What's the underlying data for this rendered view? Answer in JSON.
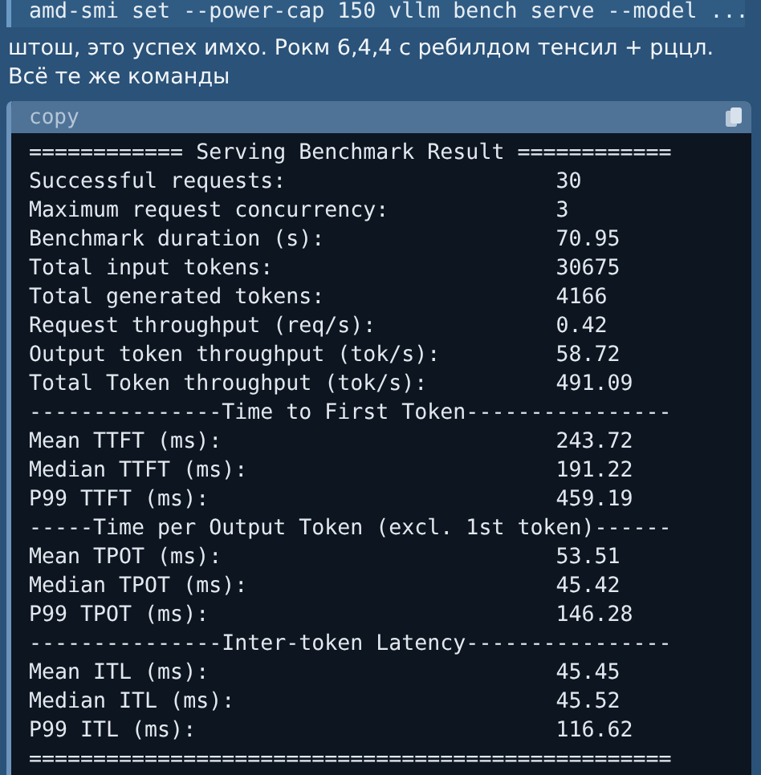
{
  "command": "amd-smi set --power-cap 150 vllm bench serve --model ...",
  "message": "штош, это успех имхо. Рокм 6,4,4 с ребилдом тенсил + рццл. Всё те же команды",
  "code_block": {
    "language_label": "copy",
    "lines": [
      {
        "kind": "rule",
        "text": "============ Serving Benchmark Result ============"
      },
      {
        "kind": "metric",
        "label": "Successful requests:",
        "value": "30"
      },
      {
        "kind": "metric",
        "label": "Maximum request concurrency:",
        "value": "3"
      },
      {
        "kind": "metric",
        "label": "Benchmark duration (s):",
        "value": "70.95"
      },
      {
        "kind": "metric",
        "label": "Total input tokens:",
        "value": "30675"
      },
      {
        "kind": "metric",
        "label": "Total generated tokens:",
        "value": "4166"
      },
      {
        "kind": "metric",
        "label": "Request throughput (req/s):",
        "value": "0.42"
      },
      {
        "kind": "metric",
        "label": "Output token throughput (tok/s):",
        "value": "58.72"
      },
      {
        "kind": "metric",
        "label": "Total Token throughput (tok/s):",
        "value": "491.09"
      },
      {
        "kind": "rule",
        "text": "---------------Time to First Token----------------"
      },
      {
        "kind": "metric",
        "label": "Mean TTFT (ms):",
        "value": "243.72"
      },
      {
        "kind": "metric",
        "label": "Median TTFT (ms):",
        "value": "191.22"
      },
      {
        "kind": "metric",
        "label": "P99 TTFT (ms):",
        "value": "459.19"
      },
      {
        "kind": "rule",
        "text": "-----Time per Output Token (excl. 1st token)------"
      },
      {
        "kind": "metric",
        "label": "Mean TPOT (ms):",
        "value": "53.51"
      },
      {
        "kind": "metric",
        "label": "Median TPOT (ms):",
        "value": "45.42"
      },
      {
        "kind": "metric",
        "label": "P99 TPOT (ms):",
        "value": "146.28"
      },
      {
        "kind": "rule",
        "text": "---------------Inter-token Latency----------------"
      },
      {
        "kind": "metric",
        "label": "Mean ITL (ms):",
        "value": "45.45"
      },
      {
        "kind": "metric",
        "label": "Median ITL (ms):",
        "value": "45.52"
      },
      {
        "kind": "metric",
        "label": "P99 ITL (ms):",
        "value": "116.62"
      },
      {
        "kind": "rule",
        "text": "=================================================="
      }
    ]
  }
}
